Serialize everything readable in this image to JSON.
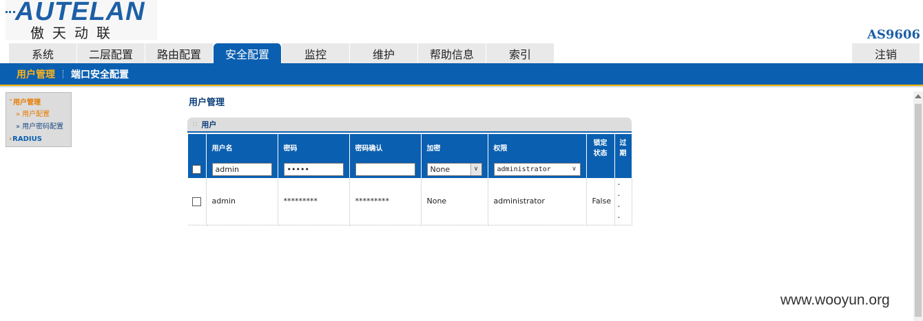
{
  "brand": {
    "name": "AUTELAN",
    "chinese": "傲天动联",
    "model": "AS9606"
  },
  "topnav": {
    "tabs": [
      "系统",
      "二层配置",
      "路由配置",
      "安全配置",
      "监控",
      "维护",
      "帮助信息",
      "索引"
    ],
    "active": "安全配置",
    "logout": "注销"
  },
  "subnav": {
    "items": [
      "用户管理",
      "端口安全配置"
    ],
    "active": "用户管理"
  },
  "tree": {
    "group1": "用户管理",
    "leaf1": "用户配置",
    "leaf2": "用户密码配置",
    "group2": "RADIUS"
  },
  "main": {
    "title": "用户管理",
    "panel_title": "用户",
    "columns": [
      "用户名",
      "密码",
      "密码确认",
      "加密",
      "权限",
      "锁定状态",
      "过期"
    ],
    "lock_col": [
      "锁定",
      "状态"
    ],
    "expire_col": [
      "过",
      "期"
    ],
    "edit_row": {
      "username": "admin",
      "password": "•••••",
      "password_confirm": "",
      "encryption": "None",
      "privilege": "administrator"
    },
    "data_row": {
      "username": "admin",
      "password": "*********",
      "password_confirm": "*********",
      "encryption": "None",
      "privilege": "administrator",
      "locked": "False",
      "expire": [
        "-",
        "-",
        "-",
        "-"
      ]
    }
  },
  "watermark": "www.wooyun.org",
  "colors": {
    "primary": "#0a5fb0",
    "accent": "#e77b00",
    "subnav_active": "#ffb31a"
  }
}
